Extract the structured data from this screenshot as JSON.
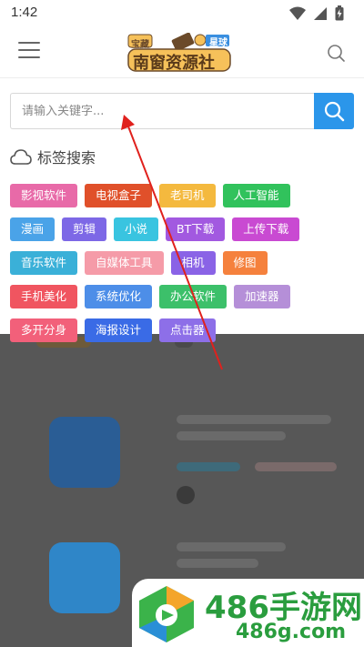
{
  "status_bar": {
    "time": "1:42"
  },
  "header": {
    "logo_line1": "宝藏",
    "logo_line2": "南窗资源社",
    "logo_badge": "星球"
  },
  "search": {
    "placeholder": "请输入关键字..."
  },
  "tags": {
    "title": "标签搜索",
    "rows": [
      [
        {
          "label": "影视软件",
          "color": "#e86aa8"
        },
        {
          "label": "电视盒子",
          "color": "#e0502a"
        },
        {
          "label": "老司机",
          "color": "#f4b93e"
        },
        {
          "label": "人工智能",
          "color": "#31c25c"
        }
      ],
      [
        {
          "label": "漫画",
          "color": "#4aa3e8"
        },
        {
          "label": "剪辑",
          "color": "#7d68e6"
        },
        {
          "label": "小说",
          "color": "#39c4e0"
        },
        {
          "label": "BT下载",
          "color": "#a259e0"
        },
        {
          "label": "上传下载",
          "color": "#c94ad2"
        }
      ],
      [
        {
          "label": "音乐软件",
          "color": "#3ab0d8"
        },
        {
          "label": "自媒体工具",
          "color": "#f59ba8"
        },
        {
          "label": "相机",
          "color": "#8a63e6"
        },
        {
          "label": "修图",
          "color": "#f5813d"
        }
      ],
      [
        {
          "label": "手机美化",
          "color": "#f05560"
        },
        {
          "label": "系统优化",
          "color": "#4d8ee8"
        },
        {
          "label": "办公软件",
          "color": "#3cc06a"
        },
        {
          "label": "加速器",
          "color": "#b58fd8"
        }
      ],
      [
        {
          "label": "多开分身",
          "color": "#f2607a"
        },
        {
          "label": "海报设计",
          "color": "#3a6be6"
        },
        {
          "label": "点击器",
          "color": "#8d6fe8"
        }
      ]
    ]
  },
  "watermark": {
    "brand": "486手游网",
    "domain": "486g.com"
  },
  "colors": {
    "search_button": "#2b96ea",
    "arrow": "#e0211d",
    "watermark": "#2a9d3e"
  }
}
